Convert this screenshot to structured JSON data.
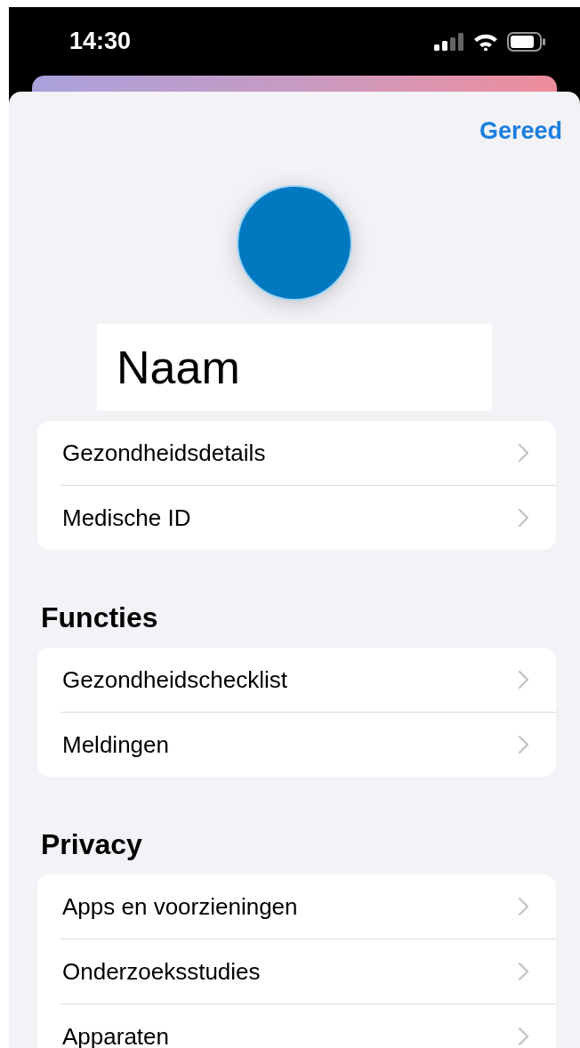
{
  "status_bar": {
    "time": "14:30"
  },
  "done_button": "Gereed",
  "profile": {
    "name": "Naam"
  },
  "groups": [
    {
      "rows": [
        "Gezondheidsdetails",
        "Medische ID"
      ]
    },
    {
      "title": "Functies",
      "rows": [
        "Gezondheidschecklist",
        "Meldingen"
      ]
    },
    {
      "title": "Privacy",
      "rows": [
        "Apps en voorzieningen",
        "Onderzoeksstudies",
        "Apparaten"
      ]
    }
  ]
}
